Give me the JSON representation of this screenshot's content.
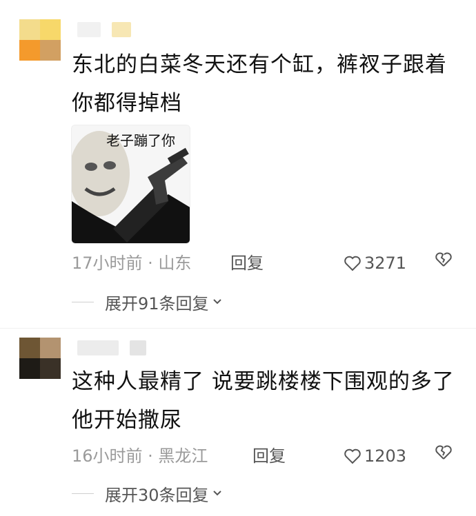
{
  "comments": [
    {
      "text": "东北的白菜冬天还有个缸，裤衩子跟着你都得掉档",
      "meme_caption": "老子蹦了你",
      "time_location": "17小时前 · 山东",
      "reply_label": "回复",
      "likes": "3271",
      "expand_label": "展开91条回复"
    },
    {
      "text": "这种人最精了 说要跳楼楼下围观的多了他开始撒尿",
      "time_location": "16小时前 · 黑龙江",
      "reply_label": "回复",
      "likes": "1203",
      "expand_label": "展开30条回复"
    }
  ],
  "colors": {
    "avatar1": [
      "#f3dc8c",
      "#f7d86a",
      "#f49a2c",
      "#d2a062"
    ],
    "avatar2": [
      "#6e5634",
      "#b39370",
      "#1e1b16",
      "#3a3127"
    ],
    "username_blur": "#e9e9e9"
  },
  "icons": [
    "heart-icon",
    "broken-heart-icon",
    "chevron-down-icon"
  ]
}
